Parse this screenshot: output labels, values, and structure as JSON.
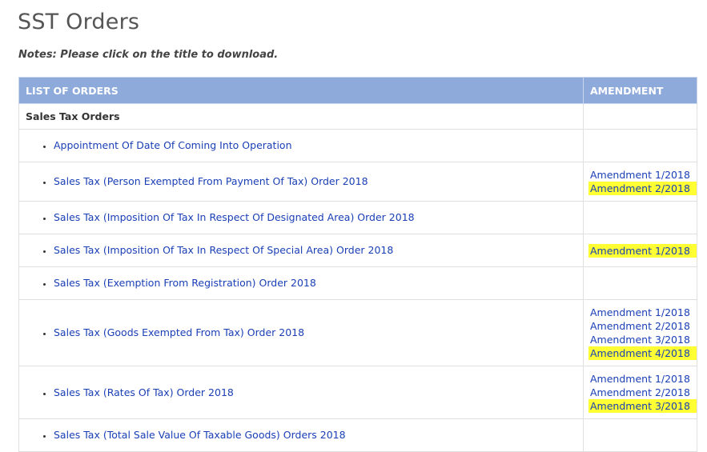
{
  "page": {
    "title": "SST Orders",
    "notes": "Notes: Please click on the title to download."
  },
  "table": {
    "headers": [
      "LIST OF ORDERS",
      "AMENDMENT"
    ],
    "group_label": "Sales Tax Orders",
    "rows": [
      {
        "title": "Appointment Of Date Of Coming Into Operation",
        "amendments": []
      },
      {
        "title": "Sales Tax (Person Exempted From Payment Of Tax) Order 2018",
        "amendments": [
          "Amendment 1/2018",
          "Amendment 2/2018"
        ]
      },
      {
        "title": "Sales Tax (Imposition Of Tax In Respect Of Designated Area) Order 2018",
        "amendments": []
      },
      {
        "title": "Sales Tax (Imposition Of Tax In Respect Of Special Area) Order 2018",
        "amendments": [
          "Amendment 1/2018"
        ]
      },
      {
        "title": "Sales Tax (Exemption From Registration) Order 2018",
        "amendments": []
      },
      {
        "title": "Sales Tax (Goods Exempted From Tax) Order 2018",
        "amendments": [
          "Amendment 1/2018",
          "Amendment 2/2018",
          "Amendment 3/2018",
          "Amendment 4/2018"
        ]
      },
      {
        "title": "Sales Tax (Rates Of Tax) Order 2018",
        "amendments": [
          "Amendment 1/2018",
          "Amendment 2/2018",
          "Amendment 3/2018"
        ]
      },
      {
        "title": "Sales Tax (Total Sale Value Of Taxable Goods) Orders 2018",
        "amendments": []
      }
    ]
  },
  "colors": {
    "header_bg": "#8eaadb",
    "link": "#1a3fb5",
    "highlight": "#ffff33"
  }
}
